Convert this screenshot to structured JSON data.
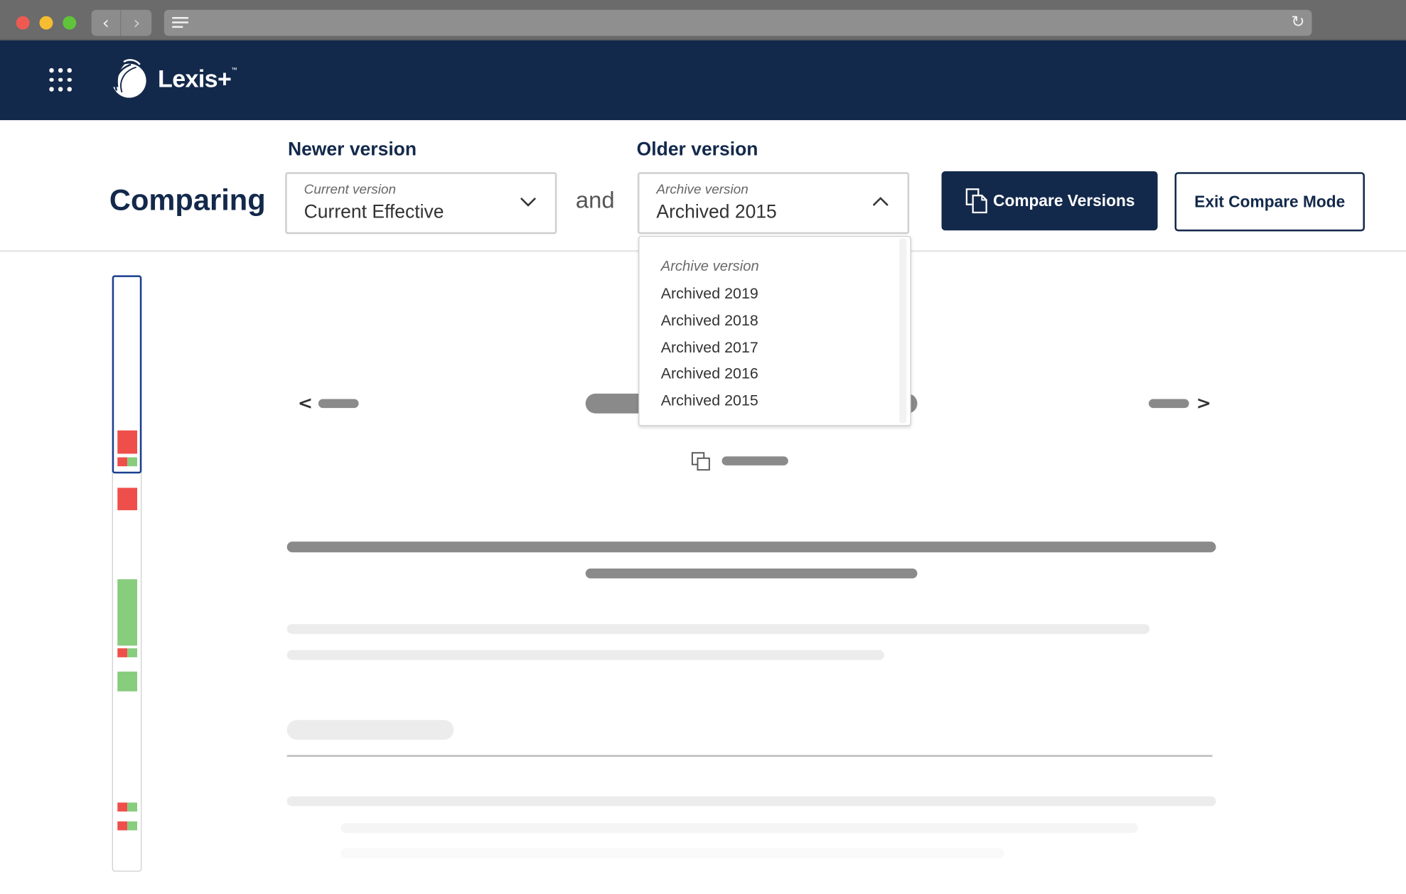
{
  "browser": {
    "back_glyph": "‹",
    "forward_glyph": "›",
    "reload_glyph": "↻"
  },
  "header": {
    "brand": "Lexis+",
    "tm": "™"
  },
  "compare": {
    "title": "Comparing",
    "newer_label": "Newer version",
    "newer_small": "Current version",
    "newer_value": "Current Effective",
    "connector": "and",
    "older_label": "Older version",
    "older_small": "Archive version",
    "older_value": "Archived 2015",
    "compare_button": "Compare Versions",
    "exit_button": "Exit Compare Mode"
  },
  "dropdown": {
    "header": "Archive version",
    "options": [
      "Archived 2019",
      "Archived 2018",
      "Archived 2017",
      "Archived 2016",
      "Archived 2015"
    ],
    "selected": "Archived 2015"
  },
  "doc_nav": {
    "prev": "<",
    "next": ">"
  },
  "colors": {
    "navy": "#13294b",
    "deleted": "#ef4f4a",
    "added": "#88cc7e"
  },
  "icons": [
    "grid-menu-icon",
    "lexis-logo-icon",
    "chevron-down-icon",
    "chevron-up-icon",
    "compare-documents-icon",
    "copy-icon"
  ]
}
